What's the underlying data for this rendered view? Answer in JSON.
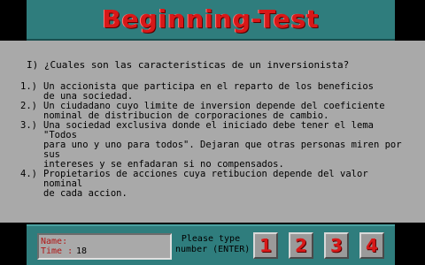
{
  "header": {
    "title": "Beginning-Test"
  },
  "question": {
    "text": "I) ¿Cuales son las caracteristicas de un inversionista?"
  },
  "answers": [
    {
      "number": "1.)",
      "text": "Un accionista que participa en el reparto de los beneficios\nde una sociedad."
    },
    {
      "number": "2.)",
      "text": "Un ciudadano cuyo limite de inversion depende del coeficiente\nnominal de distribucion de corporaciones de cambio."
    },
    {
      "number": "3.)",
      "text": "Una sociedad exclusiva donde el iniciado debe tener el lema \"Todos\npara uno y uno para todos\". Dejaran que otras personas miren por sus\nintereses y se enfadaran si no compensados."
    },
    {
      "number": "4.)",
      "text": "Propietarios de acciones cuya retibucion depende del valor nominal\nde cada accion."
    }
  ],
  "status": {
    "name_label": "Name:",
    "name_value": "",
    "time_label": "Time :",
    "time_value": "18"
  },
  "prompt": {
    "line1": "Please type",
    "line2": "number (ENTER)"
  },
  "keys": [
    "1",
    "2",
    "3",
    "4"
  ],
  "colors": {
    "panel_teal": "#2f7d7d",
    "panel_gray": "#a9a9a9",
    "accent_red": "#d81818",
    "background": "#000000"
  }
}
